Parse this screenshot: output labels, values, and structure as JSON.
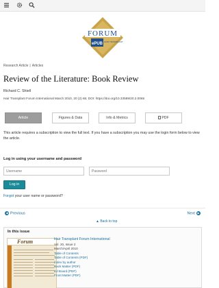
{
  "toolbar": {
    "menu_icon": "menu-icon",
    "settings_icon": "gear-icon",
    "search_icon": "search-icon"
  },
  "logo": {
    "top_text": "FORUM",
    "epub_text": "ePUB",
    "right_text": "HAIR TRANSPLANT"
  },
  "breadcrumb": {
    "item1": "Research Article",
    "separator": "|",
    "item2": "Articles"
  },
  "article": {
    "title": "Review of the Literature: Book Review",
    "author": "Richard C. Shiell",
    "citation": "Hair Transplant Forum International March 2010, 20 (2) 65; DOI: https://doi.org/10.33589/20.2.0065"
  },
  "tabs": [
    {
      "label": "Article"
    },
    {
      "label": "Figures & Data"
    },
    {
      "label": "Info & Metrics"
    },
    {
      "label": "PDF"
    }
  ],
  "notice": "This article requires a subscription to view the full text. If you have a subscription you may use the login form below to view the article.",
  "login": {
    "heading": "Log in using your username and password",
    "username_placeholder": "Username",
    "password_placeholder": "Password",
    "button_label": "Log in",
    "forgot_link": "Forgot",
    "forgot_rest": " your user name or password?"
  },
  "pager": {
    "previous": "Previous",
    "next": "Next",
    "back_to_top": "Back to top"
  },
  "issue": {
    "heading": "In this issue",
    "cover_title": "Forum",
    "journal": "Hair Transplant Forum International",
    "volume": "Vol. 20, Issue 2",
    "date": "March/April 2010",
    "links": [
      "Table of Contents",
      "Table of Contents (PDF)",
      "Index by author",
      "Back Matter (PDF)",
      "Ed Board (PDF)",
      "Front Matter (PDF)"
    ]
  },
  "colors": {
    "accent": "#1a6f9b",
    "button": "#1b8a99",
    "logo_gold": "#c9a34a",
    "logo_blue": "#1e4f8a"
  }
}
